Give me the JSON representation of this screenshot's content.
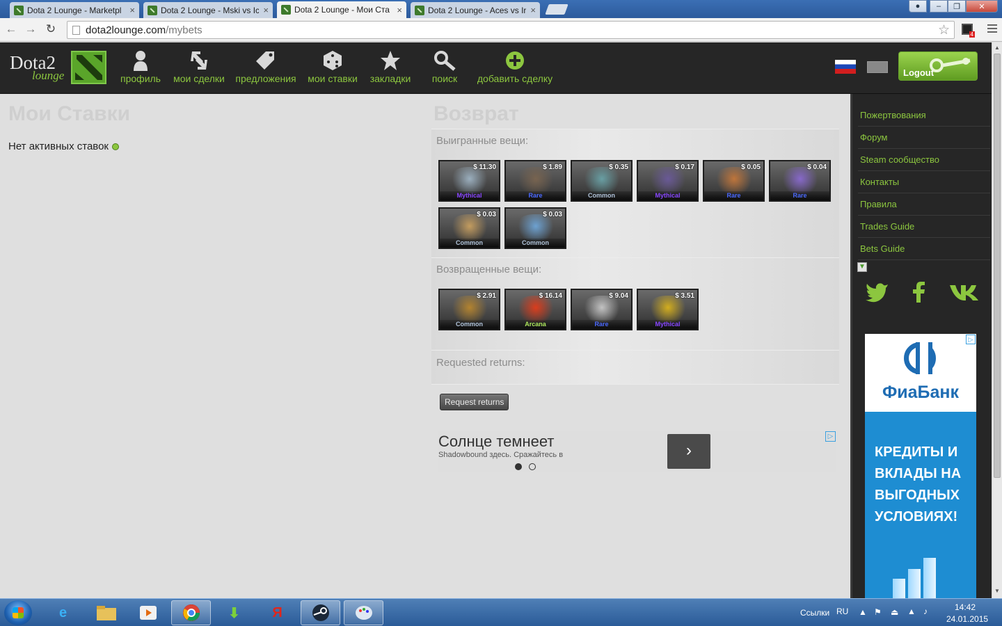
{
  "browser": {
    "tabs": [
      {
        "title": "Dota 2 Lounge - Marketpl",
        "close": "×"
      },
      {
        "title": "Dota 2 Lounge - Mski vs Ic",
        "close": "×"
      },
      {
        "title": "Dota 2 Lounge - Мои Ста",
        "close": "×"
      },
      {
        "title": "Dota 2 Lounge - Aces vs Ir",
        "close": "×"
      }
    ],
    "active_tab": 2,
    "url_domain": "dota2lounge.com",
    "url_path": "/mybets",
    "extension_badge": "4"
  },
  "site": {
    "logo_word1": "Dota2",
    "logo_word2": "lounge",
    "nav": [
      {
        "label": "профиль",
        "icon": "user-icon"
      },
      {
        "label": "мои сделки",
        "icon": "trades-icon"
      },
      {
        "label": "предложения",
        "icon": "tag-icon"
      },
      {
        "label": "мои ставки",
        "icon": "dice-icon"
      },
      {
        "label": "закладки",
        "icon": "star-icon"
      },
      {
        "label": "поиск",
        "icon": "search-icon"
      },
      {
        "label": "добавить сделку",
        "icon": "plus-circle-icon"
      }
    ],
    "logout_label": "Logout",
    "accent_color": "#8cc63f"
  },
  "left": {
    "title": "Мои Ставки",
    "no_active": "Нет активных ставок"
  },
  "right": {
    "title": "Возврат",
    "won_label": "Выигранные вещи:",
    "won_items": [
      {
        "price": "$ 11.30",
        "rarity": "Mythical"
      },
      {
        "price": "$ 1.89",
        "rarity": "Rare"
      },
      {
        "price": "$ 0.35",
        "rarity": "Common"
      },
      {
        "price": "$ 0.17",
        "rarity": "Mythical"
      },
      {
        "price": "$ 0.05",
        "rarity": "Rare"
      },
      {
        "price": "$ 0.04",
        "rarity": "Rare"
      },
      {
        "price": "$ 0.03",
        "rarity": "Common"
      },
      {
        "price": "$ 0.03",
        "rarity": "Common"
      }
    ],
    "returned_label": "Возвращенные вещи:",
    "returned_items": [
      {
        "price": "$ 2.91",
        "rarity": "Common"
      },
      {
        "price": "$ 16.14",
        "rarity": "Arcana"
      },
      {
        "price": "$ 9.04",
        "rarity": "Rare"
      },
      {
        "price": "$ 3.51",
        "rarity": "Mythical"
      }
    ],
    "requested_label": "Requested returns:",
    "request_button": "Request returns",
    "rarity_colors": {
      "Mythical": "#8847ff",
      "Rare": "#4b69ff",
      "Common": "#b0c3d9",
      "Arcana": "#ade55c"
    }
  },
  "ad1": {
    "headline": "Солнце темнеет",
    "sub": "Shadowbound здесь. Сражайтесь в",
    "go": "›"
  },
  "sidebar": {
    "links": [
      "Пожертвования",
      "Форум",
      "Steam сообщество",
      "Контакты",
      "Правила",
      "Trades Guide",
      "Bets Guide"
    ],
    "social": [
      "twitter-icon",
      "facebook-icon",
      "vk-icon"
    ]
  },
  "ad2": {
    "brand": "ФиаБанк",
    "slogan": "КРЕДИТЫ И ВКЛАДЫ НА ВЫГОДНЫХ УСЛОВИЯХ!"
  },
  "taskbar": {
    "links_label": "Ссылки",
    "lang": "RU",
    "time": "14:42",
    "date": "24.01.2015"
  }
}
